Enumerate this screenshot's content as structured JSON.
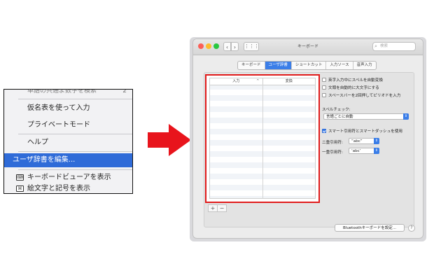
{
  "ime_menu": {
    "cut_item": "単語の共通よ数字を検索",
    "cut_item_num": "2",
    "items": [
      {
        "label": "仮名表を使って入力"
      },
      {
        "label": "プライベートモード"
      },
      {
        "label": "ヘルプ"
      },
      {
        "label": "ユーザ辞書を編集..."
      },
      {
        "label": "キーボードビューアを表示"
      },
      {
        "label": "絵文字と記号を表示"
      }
    ]
  },
  "window": {
    "title": "キーボード",
    "search_placeholder": "検索",
    "tabs": [
      {
        "label": "キーボード"
      },
      {
        "label": "ユーザ辞書",
        "active": true
      },
      {
        "label": "ショートカット"
      },
      {
        "label": "入力ソース"
      },
      {
        "label": "音声入力"
      }
    ],
    "dictionary": {
      "col_input": "入力",
      "col_convert": "変換",
      "add": "+",
      "remove": "−"
    },
    "options": {
      "autocorrect": "英字入力中にスペルを自動変換",
      "capitalize": "文頭を自動的に大文字にする",
      "double_space": "スペースバーを2回押してピリオドを入力",
      "spelling_label": "スペルチェック:",
      "spelling_value": "言語ごとに自動",
      "smart_quotes": "スマート引用符とスマートダッシュを使用",
      "double_quotes_label": "二重引用符:",
      "double_quotes_value": "“abc”",
      "single_quotes_label": "一重引用符:",
      "single_quotes_value": "‘abc’"
    },
    "bluetooth_button": "Bluetoothキーボードを設定...",
    "help": "?"
  },
  "colors": {
    "highlight": "#2f6bd8",
    "arrow": "#e8141c",
    "dict_frame": "#e11b1b",
    "accent": "#3b7ee8"
  }
}
